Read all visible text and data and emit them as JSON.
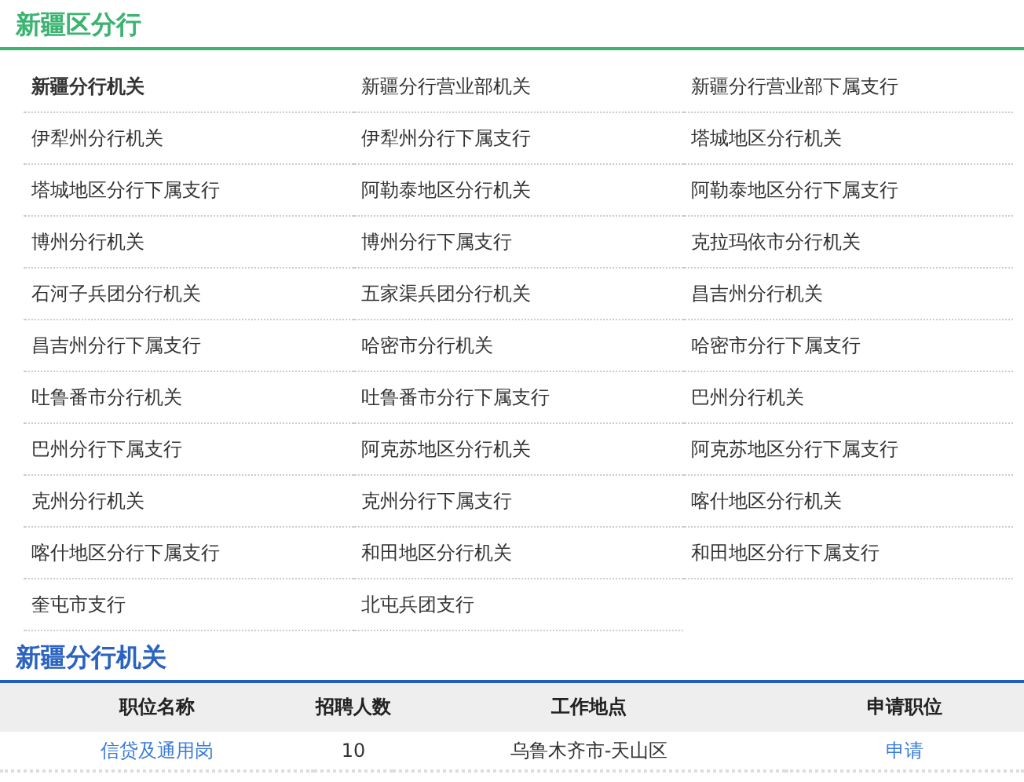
{
  "region": {
    "title": "新疆区分行"
  },
  "branches": [
    {
      "label": "新疆分行机关",
      "selected": true
    },
    {
      "label": "新疆分行营业部机关",
      "selected": false
    },
    {
      "label": "新疆分行营业部下属支行",
      "selected": false
    },
    {
      "label": "伊犁州分行机关",
      "selected": false
    },
    {
      "label": "伊犁州分行下属支行",
      "selected": false
    },
    {
      "label": "塔城地区分行机关",
      "selected": false
    },
    {
      "label": "塔城地区分行下属支行",
      "selected": false
    },
    {
      "label": "阿勒泰地区分行机关",
      "selected": false
    },
    {
      "label": "阿勒泰地区分行下属支行",
      "selected": false
    },
    {
      "label": "博州分行机关",
      "selected": false
    },
    {
      "label": "博州分行下属支行",
      "selected": false
    },
    {
      "label": "克拉玛依市分行机关",
      "selected": false
    },
    {
      "label": "石河子兵团分行机关",
      "selected": false
    },
    {
      "label": "五家渠兵团分行机关",
      "selected": false
    },
    {
      "label": "昌吉州分行机关",
      "selected": false
    },
    {
      "label": "昌吉州分行下属支行",
      "selected": false
    },
    {
      "label": "哈密市分行机关",
      "selected": false
    },
    {
      "label": "哈密市分行下属支行",
      "selected": false
    },
    {
      "label": "吐鲁番市分行机关",
      "selected": false
    },
    {
      "label": "吐鲁番市分行下属支行",
      "selected": false
    },
    {
      "label": "巴州分行机关",
      "selected": false
    },
    {
      "label": "巴州分行下属支行",
      "selected": false
    },
    {
      "label": "阿克苏地区分行机关",
      "selected": false
    },
    {
      "label": "阿克苏地区分行下属支行",
      "selected": false
    },
    {
      "label": "克州分行机关",
      "selected": false
    },
    {
      "label": "克州分行下属支行",
      "selected": false
    },
    {
      "label": "喀什地区分行机关",
      "selected": false
    },
    {
      "label": "喀什地区分行下属支行",
      "selected": false
    },
    {
      "label": "和田地区分行机关",
      "selected": false
    },
    {
      "label": "和田地区分行下属支行",
      "selected": false
    },
    {
      "label": "奎屯市支行",
      "selected": false
    },
    {
      "label": "北屯兵团支行",
      "selected": false
    }
  ],
  "section": {
    "title": "新疆分行机关"
  },
  "table": {
    "columns": [
      "职位名称",
      "招聘人数",
      "工作地点",
      "申请职位"
    ],
    "rows": [
      {
        "position": "信贷及通用岗",
        "count": "10",
        "location": "乌鲁木齐市-天山区",
        "apply": "申请"
      }
    ]
  }
}
